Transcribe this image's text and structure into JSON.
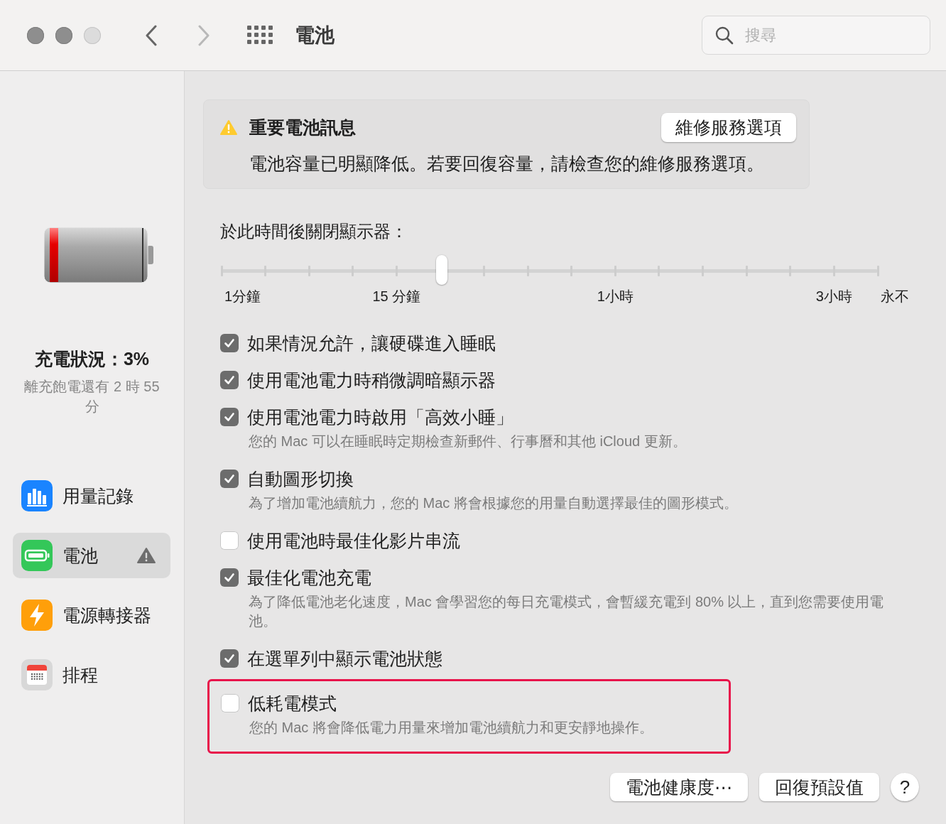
{
  "window": {
    "title": "電池"
  },
  "search": {
    "placeholder": "搜尋"
  },
  "sidebar": {
    "status": "充電狀況：3%",
    "detail": "離充飽電還有 2 時 55 分",
    "items": [
      {
        "label": "用量記錄",
        "kind": "chart",
        "selected": false,
        "warning": false
      },
      {
        "label": "電池",
        "kind": "battery",
        "selected": true,
        "warning": true
      },
      {
        "label": "電源轉接器",
        "kind": "bolt",
        "selected": false,
        "warning": false
      },
      {
        "label": "排程",
        "kind": "calendar",
        "selected": false,
        "warning": false
      }
    ]
  },
  "notice": {
    "title": "重要電池訊息",
    "button": "維修服務選項",
    "message": "電池容量已明顯降低。若要回復容量，請檢查您的維修服務選項。"
  },
  "display_off": {
    "label": "於此時間後關閉顯示器：",
    "level": 0.335,
    "scale": [
      "1分鐘",
      "15 分鐘",
      "1小時",
      "3小時",
      "永不"
    ]
  },
  "options": [
    {
      "label": "如果情況允許，讓硬碟進入睡眠",
      "checked": true,
      "highlighted": false
    },
    {
      "label": "使用電池電力時稍微調暗顯示器",
      "checked": true,
      "highlighted": false
    },
    {
      "label": "使用電池電力時啟用「高效小睡」",
      "checked": true,
      "highlighted": false,
      "description": "您的 Mac 可以在睡眠時定期檢查新郵件、行事曆和其他 iCloud 更新。"
    },
    {
      "label": "自動圖形切換",
      "checked": true,
      "highlighted": false,
      "description": "為了增加電池續航力，您的 Mac 將會根據您的用量自動選擇最佳的圖形模式。"
    },
    {
      "label": "使用電池時最佳化影片串流",
      "checked": false,
      "highlighted": false
    },
    {
      "label": "最佳化電池充電",
      "checked": true,
      "highlighted": false,
      "description": "為了降低電池老化速度，Mac 會學習您的每日充電模式，會暫緩充電到 80% 以上，直到您需要使用電池。"
    },
    {
      "label": "在選單列中顯示電池狀態",
      "checked": true,
      "highlighted": false
    },
    {
      "label": "低耗電模式",
      "checked": false,
      "highlighted": true,
      "description": "您的 Mac 將會降低電力用量來增加電池續航力和更安靜地操作。"
    }
  ],
  "buttons": [
    "電池健康度⋯",
    "回復預設值"
  ],
  "help": "?"
}
